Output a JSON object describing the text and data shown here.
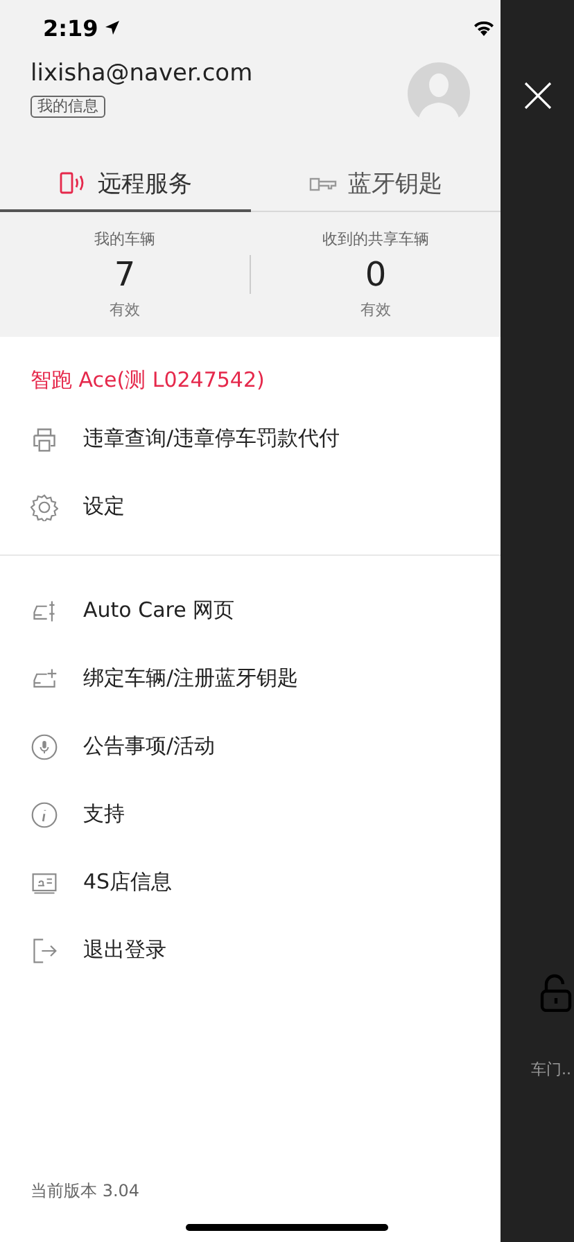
{
  "status_bar": {
    "time": "2:19"
  },
  "account": {
    "email": "lixisha@naver.com",
    "info_button": "我的信息"
  },
  "tabs": [
    {
      "label": "远程服务",
      "kind": "remote",
      "selected": true
    },
    {
      "label": "蓝牙钥匙",
      "kind": "key",
      "selected": false
    }
  ],
  "stats": [
    {
      "label": "我的车辆",
      "value": "7",
      "status": "有效"
    },
    {
      "label": "收到的共享车辆",
      "value": "0",
      "status": "有效"
    }
  ],
  "vehicle_title": "智跑 Ace(测 L0247542)",
  "menu_sections": [
    [
      {
        "label": "违章查询/违章停车罚款代付",
        "kind": "violation"
      },
      {
        "label": "设定",
        "kind": "settings"
      }
    ],
    [
      {
        "label": "Auto Care 网页",
        "kind": "autocare"
      },
      {
        "label": "绑定车辆/注册蓝牙钥匙",
        "kind": "addcar"
      },
      {
        "label": "公告事项/活动",
        "kind": "notice"
      },
      {
        "label": "支持",
        "kind": "info"
      },
      {
        "label": "4S店信息",
        "kind": "dealer"
      },
      {
        "label": "退出登录",
        "kind": "logout"
      }
    ]
  ],
  "version": "当前版本 3.04",
  "background": {
    "door_label": "车门.."
  }
}
